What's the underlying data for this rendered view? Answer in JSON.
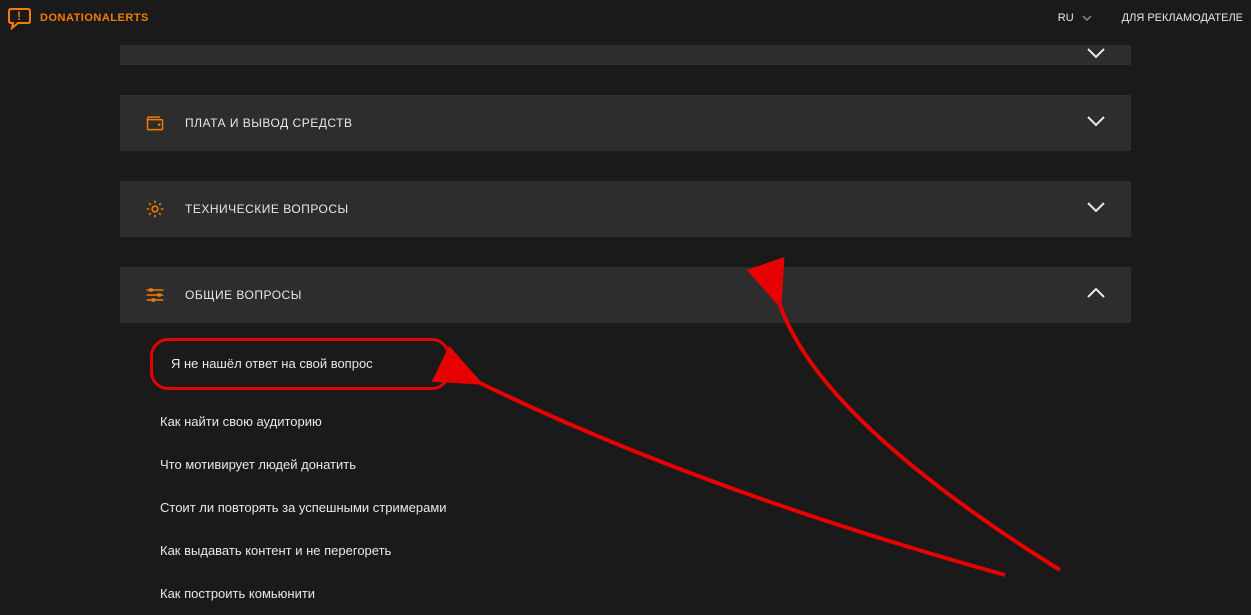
{
  "header": {
    "brand": "DONATIONALERTS",
    "language": "RU",
    "advertiser_link": "ДЛЯ РЕКЛАМОДАТЕЛЕ"
  },
  "sections": {
    "collapsed_top": "",
    "payments": {
      "title": "ПЛАТА И ВЫВОД СРЕДСТВ"
    },
    "technical": {
      "title": "ТЕХНИЧЕСКИЕ ВОПРОСЫ"
    },
    "general": {
      "title": "ОБЩИЕ ВОПРОСЫ",
      "items": [
        "Я не нашёл ответ на свой вопрос",
        "Как найти свою аудиторию",
        "Что мотивирует людей донатить",
        "Стоит ли повторять за успешными стримерами",
        "Как выдавать контент и не перегореть",
        "Как построить комьюнити"
      ]
    }
  },
  "colors": {
    "accent": "#f57c00",
    "annotation": "#e60000"
  }
}
